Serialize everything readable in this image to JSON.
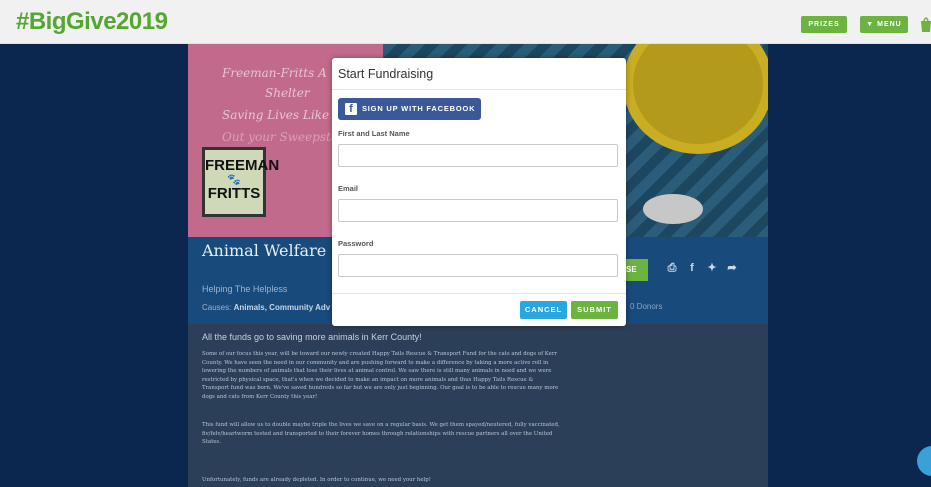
{
  "header": {
    "brand": "#BigGive2019",
    "prizes_label": "PRIZES",
    "menu_label": "▼ MENU"
  },
  "campaign": {
    "hero_script_lines": [
      "Freeman-Fritts A",
      "Shelter",
      "Saving Lives Like",
      "Out your Sweepstakes"
    ],
    "logo_line1": "FREEMAN",
    "logo_line2": "FRITTS",
    "title": "Animal Welfare S County Texas",
    "tagline": "Helping The Helpless",
    "causes_prefix": "Causes:",
    "causes_value": "Animals, Community Adv",
    "donate_fragment": "SE",
    "donors_fragment": "0 Donors"
  },
  "story": {
    "headline": "All the funds go to saving more animals in Kerr County!",
    "para1": "Some of our focus this year, will be toward our newly created Happy Tails Rescue & Transport Fund for the cats and dogs of Kerr County. We have seen the need in our community and are pushing forward to make a difference by taking a more active roll in lowering the numbers of animals that lose their lives at animal control. We saw there is still many animals in need and we were restricted by physical space, that's when we decided to make an impact on more animals and thus Happy Tails Rescue & Transport fund was born. We've saved hundreds so far but we are only just beginning. Our goal is to be able to rescue many more dogs and cats from Kerr County this year!",
    "para2": "This fund will allow us to double maybe triple the lives we save on a regular basis. We get them spayed/neutered, fully vaccinated, fiv/felv/heartworm tested and transported to their forever homes through relationships with rescue partners all over the United States.",
    "para3": "Unfortunately, funds are already depleted. In order to continue, we need your help!"
  },
  "modal": {
    "title": "Start Fundraising",
    "facebook_label": "SIGN UP WITH FACEBOOK",
    "name_label": "First and Last Name",
    "name_value": "",
    "email_label": "Email",
    "email_value": "",
    "password_label": "Password",
    "password_value": "",
    "cancel_label": "CANCEL",
    "submit_label": "SUBMIT"
  },
  "colors": {
    "brand_green": "#55a632",
    "button_green": "#6cb33f",
    "facebook_blue": "#3b5998",
    "cancel_blue": "#29a8df"
  }
}
